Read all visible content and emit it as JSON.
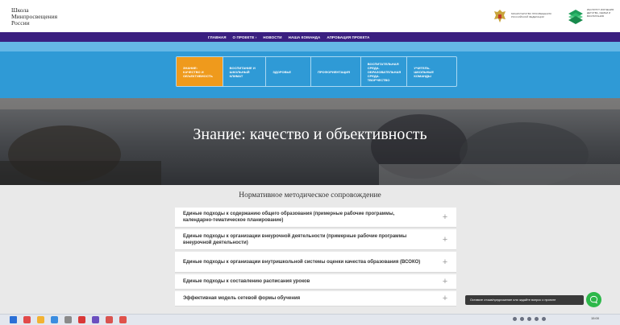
{
  "header": {
    "logo_lines": [
      "Школа",
      "Минпросвещения",
      "России"
    ],
    "ministry_name": "МИНИСТЕРСТВО ПРОСВЕЩЕНИЯ РОССИЙСКОЙ ФЕДЕРАЦИИ",
    "institute_name": "ИНСТИТУТ ИЗУЧЕНИЯ ДЕТСТВА, СЕМЬИ И ВОСПИТАНИЯ"
  },
  "nav": {
    "items": [
      "ГЛАВНАЯ",
      "О ПРОЕКТЕ ›",
      "НОВОСТИ",
      "НАША КОМАНДА",
      "АПРОБАЦИЯ ПРОЕКТА"
    ]
  },
  "directions": {
    "tabs": [
      {
        "label": "ЗНАНИЕ:\nКАЧЕСТВО И\nОБЪЕКТИВНОСТЬ",
        "active": true
      },
      {
        "label": "ВОСПИТАНИЕ И\nШКОЛЬНЫЙ\nКЛИМАТ",
        "active": false
      },
      {
        "label": "ЗДОРОВЬЕ",
        "active": false
      },
      {
        "label": "ПРОФОРИЕНТАЦИЯ",
        "active": false
      },
      {
        "label": "ВОСПИТАТЕЛЬНАЯ\nСРЕДА.\nОБРАЗОВАТЕЛЬНАЯ\nСРЕДА.\nТВОРЧЕСТВО",
        "active": false
      },
      {
        "label": "УЧИТЕЛЬ.\nШКОЛЬНЫЕ\nКОМАНДЫ",
        "active": false
      }
    ]
  },
  "hero": {
    "title": "Знание: качество и объективность"
  },
  "section": {
    "title": "Нормативное методическое сопровождение",
    "items": [
      "Единые подходы к содержанию общего образования (примерные рабочие программы, календарно-тематическое планирование)",
      "Единые подходы к организации внеурочной деятельности (примерные рабочие программы внеурочной деятельности)",
      "Единые подходы к организации внутришкольной системы оценки качества образования (ВСОКО)",
      "Единые подходы к составлению расписания уроков",
      "Эффективная модель сетевой формы обучения"
    ],
    "expand_symbol": "+"
  },
  "feedback": {
    "bubble_text": "Оставьте отзыв/предложение или задайте вопрос о проекте"
  },
  "taskbar": {
    "time": "15:00",
    "date": "",
    "icon_colors": [
      "#2b6fd6",
      "#e24a4a",
      "#f2b233",
      "#3a8de0",
      "#8a8a8a",
      "#d93838",
      "#6b4fbf",
      "#d9534f",
      "#e0524b"
    ]
  },
  "colors": {
    "nav_bg": "#3a1f80",
    "band_bg": "#2f9ad6",
    "active_tab": "#ef9a1c",
    "chat_button": "#2db84a"
  }
}
